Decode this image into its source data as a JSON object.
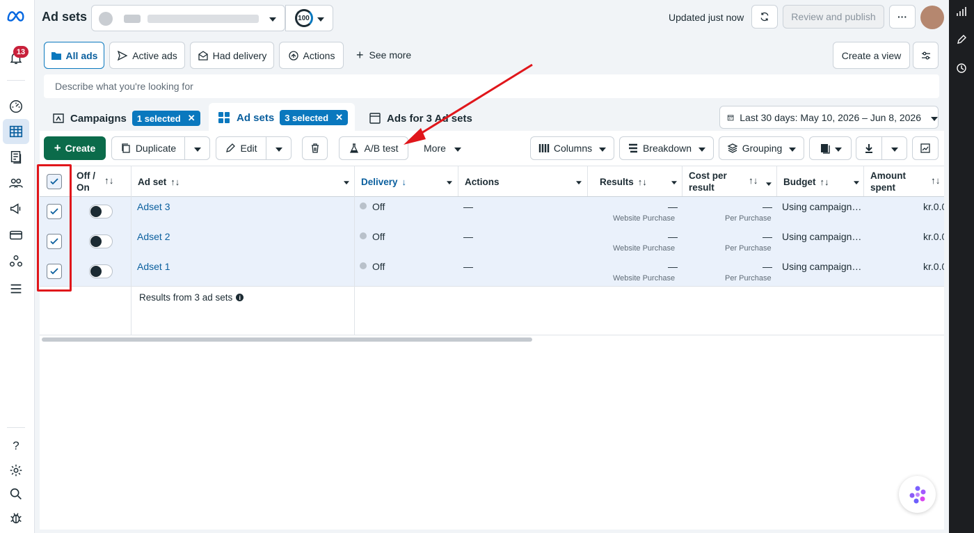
{
  "header": {
    "title": "Ad sets",
    "account_score": "100",
    "updated": "Updated just now",
    "review_publish": "Review and publish",
    "more_dots": "···"
  },
  "notifications": {
    "count": "13"
  },
  "filters": {
    "all_ads": "All ads",
    "active_ads": "Active ads",
    "had_delivery": "Had delivery",
    "actions": "Actions",
    "see_more": "See more",
    "create_view": "Create a view"
  },
  "search": {
    "placeholder": "Describe what you're looking for"
  },
  "levels": {
    "campaigns": "Campaigns",
    "campaigns_selected": "1 selected",
    "adsets": "Ad sets",
    "adsets_selected": "3 selected",
    "ads": "Ads for 3 Ad sets"
  },
  "date_range": "Last 30 days: May 10, 2026 – Jun 8, 2026",
  "toolbar": {
    "create": "Create",
    "duplicate": "Duplicate",
    "edit": "Edit",
    "ab_test": "A/B test",
    "more": "More",
    "columns": "Columns",
    "breakdown": "Breakdown",
    "grouping": "Grouping"
  },
  "table": {
    "headers": {
      "offon": "Off /",
      "offon2": "On",
      "adset": "Ad set",
      "delivery": "Delivery",
      "actions": "Actions",
      "results": "Results",
      "cost": "Cost per",
      "cost2": "result",
      "budget": "Budget",
      "amount": "Amount",
      "amount2": "spent"
    },
    "rows": [
      {
        "name": "Adset 3",
        "delivery": "Off",
        "actions": "—",
        "results": "—",
        "results_sub": "Website Purchase",
        "cost": "—",
        "cost_sub": "Per Purchase",
        "budget": "Using campaign…",
        "amount": "kr.0.0"
      },
      {
        "name": "Adset 2",
        "delivery": "Off",
        "actions": "—",
        "results": "—",
        "results_sub": "Website Purchase",
        "cost": "—",
        "cost_sub": "Per Purchase",
        "budget": "Using campaign…",
        "amount": "kr.0.0"
      },
      {
        "name": "Adset 1",
        "delivery": "Off",
        "actions": "—",
        "results": "—",
        "results_sub": "Website Purchase",
        "cost": "—",
        "cost_sub": "Per Purchase",
        "budget": "Using campaign…",
        "amount": "kr.0.0"
      }
    ],
    "footer": "Results from 3 ad sets"
  },
  "help": {
    "question": "?"
  },
  "colors": {
    "accent": "#0a78be",
    "create_green": "#0b6b4a",
    "annotation_red": "#e0161b",
    "selected_row": "#eaf1fb"
  }
}
